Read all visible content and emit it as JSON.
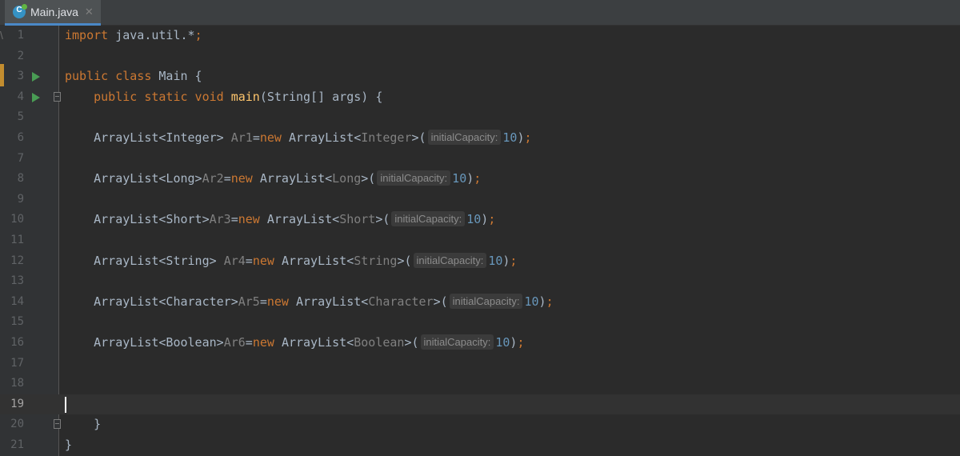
{
  "tab": {
    "filename": "Main.java",
    "icon": "java-class-icon",
    "icon_letter": "C",
    "close": "✕"
  },
  "gutter": {
    "marker": "\\"
  },
  "colors": {
    "background": "#2b2b2b",
    "gutter": "#313335",
    "keyword": "#cc7832",
    "method": "#ffc66d",
    "identifier": "#a9b7c6",
    "type_param": "#808080",
    "number": "#6897bb",
    "run": "#499c54",
    "tab_underline": "#4a88c7"
  },
  "current_line": 19,
  "lines": [
    {
      "n": "1",
      "code": [
        {
          "t": "import ",
          "c": "kw"
        },
        {
          "t": "java.util.",
          "c": ""
        },
        {
          "t": "*",
          "c": ""
        },
        {
          "t": ";",
          "c": "kw"
        }
      ]
    },
    {
      "n": "2",
      "code": []
    },
    {
      "n": "3",
      "run": true,
      "code": [
        {
          "t": "public class ",
          "c": "kw"
        },
        {
          "t": "Main {",
          "c": ""
        }
      ]
    },
    {
      "n": "4",
      "run": true,
      "fold": true,
      "code": [
        {
          "t": "    public static void ",
          "c": "kw"
        },
        {
          "t": "main",
          "c": "fn"
        },
        {
          "t": "(String[] args) {",
          "c": ""
        }
      ]
    },
    {
      "n": "5",
      "code": []
    },
    {
      "n": "6",
      "code": [
        {
          "t": "    ArrayList<Integer> ",
          "c": ""
        },
        {
          "t": "Ar1",
          "c": "tp"
        },
        {
          "t": "=",
          "c": ""
        },
        {
          "t": "new ",
          "c": "kw"
        },
        {
          "t": "ArrayList<",
          "c": ""
        },
        {
          "t": "Integer",
          "c": "tp"
        },
        {
          "t": ">(",
          "c": ""
        },
        {
          "hint": "initialCapacity:"
        },
        {
          "t": "10",
          "c": "num"
        },
        {
          "t": ")",
          "c": ""
        },
        {
          "t": ";",
          "c": "kw"
        }
      ]
    },
    {
      "n": "7",
      "code": []
    },
    {
      "n": "8",
      "code": [
        {
          "t": "    ArrayList<Long>",
          "c": ""
        },
        {
          "t": "Ar2",
          "c": "tp"
        },
        {
          "t": "=",
          "c": ""
        },
        {
          "t": "new ",
          "c": "kw"
        },
        {
          "t": "ArrayList<",
          "c": ""
        },
        {
          "t": "Long",
          "c": "tp"
        },
        {
          "t": ">(",
          "c": ""
        },
        {
          "hint": "initialCapacity:"
        },
        {
          "t": "10",
          "c": "num"
        },
        {
          "t": ")",
          "c": ""
        },
        {
          "t": ";",
          "c": "kw"
        }
      ]
    },
    {
      "n": "9",
      "code": []
    },
    {
      "n": "10",
      "code": [
        {
          "t": "    ArrayList<Short>",
          "c": ""
        },
        {
          "t": "Ar3",
          "c": "tp"
        },
        {
          "t": "=",
          "c": ""
        },
        {
          "t": "new ",
          "c": "kw"
        },
        {
          "t": "ArrayList<",
          "c": ""
        },
        {
          "t": "Short",
          "c": "tp"
        },
        {
          "t": ">(",
          "c": ""
        },
        {
          "hint": "initialCapacity:"
        },
        {
          "t": "10",
          "c": "num"
        },
        {
          "t": ")",
          "c": ""
        },
        {
          "t": ";",
          "c": "kw"
        }
      ]
    },
    {
      "n": "11",
      "code": []
    },
    {
      "n": "12",
      "code": [
        {
          "t": "    ArrayList<String> ",
          "c": ""
        },
        {
          "t": "Ar4",
          "c": "tp"
        },
        {
          "t": "=",
          "c": ""
        },
        {
          "t": "new ",
          "c": "kw"
        },
        {
          "t": "ArrayList<",
          "c": ""
        },
        {
          "t": "String",
          "c": "tp"
        },
        {
          "t": ">(",
          "c": ""
        },
        {
          "hint": "initialCapacity:"
        },
        {
          "t": "10",
          "c": "num"
        },
        {
          "t": ")",
          "c": ""
        },
        {
          "t": ";",
          "c": "kw"
        }
      ]
    },
    {
      "n": "13",
      "code": []
    },
    {
      "n": "14",
      "code": [
        {
          "t": "    ArrayList<Character>",
          "c": ""
        },
        {
          "t": "Ar5",
          "c": "tp"
        },
        {
          "t": "=",
          "c": ""
        },
        {
          "t": "new ",
          "c": "kw"
        },
        {
          "t": "ArrayList<",
          "c": ""
        },
        {
          "t": "Character",
          "c": "tp"
        },
        {
          "t": ">(",
          "c": ""
        },
        {
          "hint": "initialCapacity:"
        },
        {
          "t": "10",
          "c": "num"
        },
        {
          "t": ")",
          "c": ""
        },
        {
          "t": ";",
          "c": "kw"
        }
      ]
    },
    {
      "n": "15",
      "code": []
    },
    {
      "n": "16",
      "code": [
        {
          "t": "    ArrayList<Boolean>",
          "c": ""
        },
        {
          "t": "Ar6",
          "c": "tp"
        },
        {
          "t": "=",
          "c": ""
        },
        {
          "t": "new ",
          "c": "kw"
        },
        {
          "t": "ArrayList<",
          "c": ""
        },
        {
          "t": "Boolean",
          "c": "tp"
        },
        {
          "t": ">(",
          "c": ""
        },
        {
          "hint": "initialCapacity:"
        },
        {
          "t": "10",
          "c": "num"
        },
        {
          "t": ")",
          "c": ""
        },
        {
          "t": ";",
          "c": "kw"
        }
      ]
    },
    {
      "n": "17",
      "code": []
    },
    {
      "n": "18",
      "code": []
    },
    {
      "n": "19",
      "code": []
    },
    {
      "n": "20",
      "fold": true,
      "code": [
        {
          "t": "    }",
          "c": ""
        }
      ]
    },
    {
      "n": "21",
      "code": [
        {
          "t": "}",
          "c": ""
        }
      ]
    }
  ]
}
